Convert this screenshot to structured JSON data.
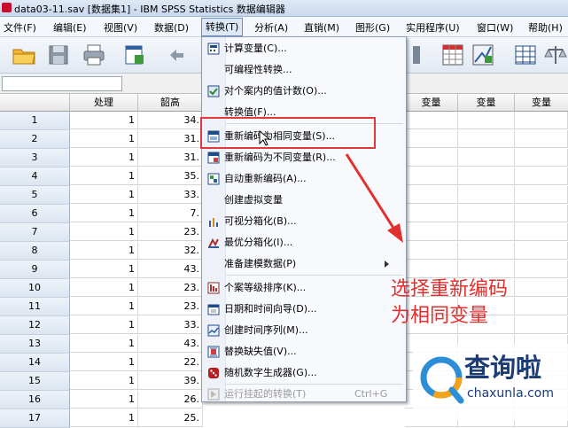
{
  "window": {
    "title": "data03-11.sav [数据集1] - IBM SPSS Statistics 数据编辑器"
  },
  "menubar": [
    {
      "label": "文件(F)"
    },
    {
      "label": "编辑(E)"
    },
    {
      "label": "视图(V)"
    },
    {
      "label": "数据(D)"
    },
    {
      "label": "转换(T)"
    },
    {
      "label": "分析(A)"
    },
    {
      "label": "直销(M)"
    },
    {
      "label": "图形(G)"
    },
    {
      "label": "实用程序(U)"
    },
    {
      "label": "窗口(W)"
    },
    {
      "label": "帮助(H)"
    }
  ],
  "grid": {
    "columns": [
      "处理",
      "韶高",
      "变量",
      "变量",
      "变量"
    ],
    "rows": [
      {
        "n": "1",
        "a": "1",
        "b": "34."
      },
      {
        "n": "2",
        "a": "1",
        "b": "31."
      },
      {
        "n": "3",
        "a": "1",
        "b": "31."
      },
      {
        "n": "4",
        "a": "1",
        "b": "35."
      },
      {
        "n": "5",
        "a": "1",
        "b": "33."
      },
      {
        "n": "6",
        "a": "1",
        "b": "7."
      },
      {
        "n": "7",
        "a": "1",
        "b": "23."
      },
      {
        "n": "8",
        "a": "1",
        "b": "32."
      },
      {
        "n": "9",
        "a": "1",
        "b": "43."
      },
      {
        "n": "10",
        "a": "1",
        "b": "23."
      },
      {
        "n": "11",
        "a": "1",
        "b": "23."
      },
      {
        "n": "12",
        "a": "1",
        "b": "33."
      },
      {
        "n": "13",
        "a": "1",
        "b": "43."
      },
      {
        "n": "14",
        "a": "1",
        "b": "22."
      },
      {
        "n": "15",
        "a": "1",
        "b": "39."
      },
      {
        "n": "16",
        "a": "1",
        "b": "26."
      },
      {
        "n": "17",
        "a": "1",
        "b": "25."
      }
    ]
  },
  "dropdown": {
    "items": [
      {
        "label": "计算变量(C)...",
        "icon": "calculator-icon"
      },
      {
        "label": "可编程性转换...",
        "icon": ""
      },
      {
        "label": "对个案内的值计数(O)...",
        "icon": "count-icon"
      },
      {
        "label": "转换值(F)...",
        "icon": ""
      },
      {
        "label": "重新编码为相同变量(S)...",
        "icon": "recode-same-icon"
      },
      {
        "label": "重新编码为不同变量(R)...",
        "icon": "recode-different-icon"
      },
      {
        "label": "自动重新编码(A)...",
        "icon": "auto-recode-icon"
      },
      {
        "label": "创建虚拟变量",
        "icon": ""
      },
      {
        "label": "可视分箱化(B)...",
        "icon": "visual-binning-icon"
      },
      {
        "label": "最优分箱化(I)...",
        "icon": "optimal-binning-icon"
      },
      {
        "label": "准备建模数据(P)",
        "icon": ""
      },
      {
        "label": "个案等级排序(K)...",
        "icon": "rank-icon"
      },
      {
        "label": "日期和时间向导(D)...",
        "icon": "date-icon"
      },
      {
        "label": "创建时间序列(M)...",
        "icon": "time-series-icon"
      },
      {
        "label": "替换缺失值(V)...",
        "icon": "replace-missing-icon"
      },
      {
        "label": "随机数字生成器(G)...",
        "icon": "dice-icon"
      },
      {
        "label": "运行挂起的转换(T)",
        "icon": "run-pending-icon",
        "shortcut": "Ctrl+G"
      }
    ]
  },
  "annotation": {
    "line1": "选择重新编码",
    "line2": "为相同变量"
  },
  "watermark": {
    "text": "查询啦",
    "url": "chaxunla.com"
  },
  "colors": {
    "highlight": "#f7dd7a",
    "annotation": "#e03030",
    "brand": "#1b3c75"
  }
}
